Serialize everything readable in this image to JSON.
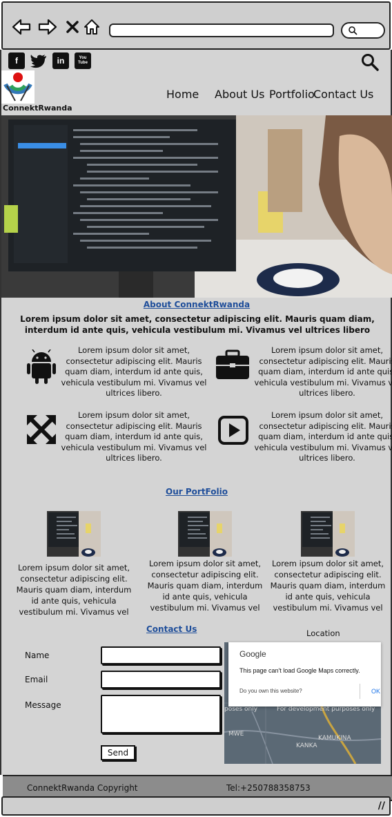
{
  "browser": {
    "icons": [
      "back-arrow-icon",
      "forward-arrow-icon",
      "close-icon",
      "home-icon"
    ],
    "search_icon": "search-icon"
  },
  "header": {
    "social": [
      {
        "name": "facebook-icon",
        "glyph": "f"
      },
      {
        "name": "twitter-icon",
        "glyph": "t"
      },
      {
        "name": "linkedin-icon",
        "glyph": "in"
      },
      {
        "name": "youtube-icon",
        "glyph": "You Tube"
      }
    ],
    "logo_text": "ConnektRwanda",
    "nav": [
      "Home",
      "About Us",
      "Portfolio",
      "Contact Us"
    ]
  },
  "about": {
    "title": "About ConnektRwanda",
    "text": "Lorem ipsum dolor sit amet, consectetur adipiscing elit. Mauris quam diam, interdum id ante quis, vehicula vestibulum mi. Vivamus vel ultrices libero",
    "features": [
      {
        "icon": "android-icon",
        "text": "Lorem ipsum dolor sit amet, consectetur adipiscing elit. Mauris quam diam, interdum id ante quis, vehicula vestibulum mi. Vivamus vel ultrices libero."
      },
      {
        "icon": "briefcase-icon",
        "text": "Lorem ipsum dolor sit amet, consectetur adipiscing elit. Mauris quam diam, interdum id ante quis, vehicula vestibulum mi. Vivamus vel ultrices libero."
      },
      {
        "icon": "expand-arrows-icon",
        "text": "Lorem ipsum dolor sit amet, consectetur adipiscing elit. Mauris quam diam, interdum id ante quis, vehicula vestibulum mi. Vivamus vel ultrices libero."
      },
      {
        "icon": "play-icon",
        "text": "Lorem ipsum dolor sit amet, consectetur adipiscing elit. Mauris quam diam, interdum id ante quis, vehicula vestibulum mi. Vivamus vel ultrices libero."
      }
    ]
  },
  "portfolio": {
    "title": "Our PortFolio",
    "items": [
      {
        "text": "Lorem ipsum dolor sit amet, consectetur adipiscing elit. Mauris quam diam, interdum id ante quis, vehicula vestibulum mi. Vivamus vel"
      },
      {
        "text": "Lorem ipsum dolor sit amet, consectetur adipiscing elit. Mauris quam diam, interdum id ante quis, vehicula vestibulum mi. Vivamus vel"
      },
      {
        "text": "Lorem ipsum dolor sit amet, consectetur adipiscing elit. Mauris quam diam, interdum id ante quis, vehicula vestibulum mi. Vivamus vel"
      }
    ]
  },
  "contact": {
    "title": "Contact Us",
    "name_label": "Name",
    "email_label": "Email",
    "message_label": "Message",
    "send_label": "Send"
  },
  "location": {
    "title": "Location",
    "google": "Google",
    "error": "This page can't load Google Maps correctly.",
    "own": "Do you own this website?",
    "ok": "OK",
    "dev_left": "poses only",
    "dev_right": "For development purposes only",
    "places": [
      "MWE",
      "KANKA",
      "KAMUKINA"
    ]
  },
  "footer": {
    "copyright": "ConnektRwanda Copyright",
    "tel": "Tel:+250788358753"
  },
  "colors": {
    "page_bg": "#d4d4d4",
    "link": "#1f4e9a",
    "footer": "#8c8c8c"
  }
}
